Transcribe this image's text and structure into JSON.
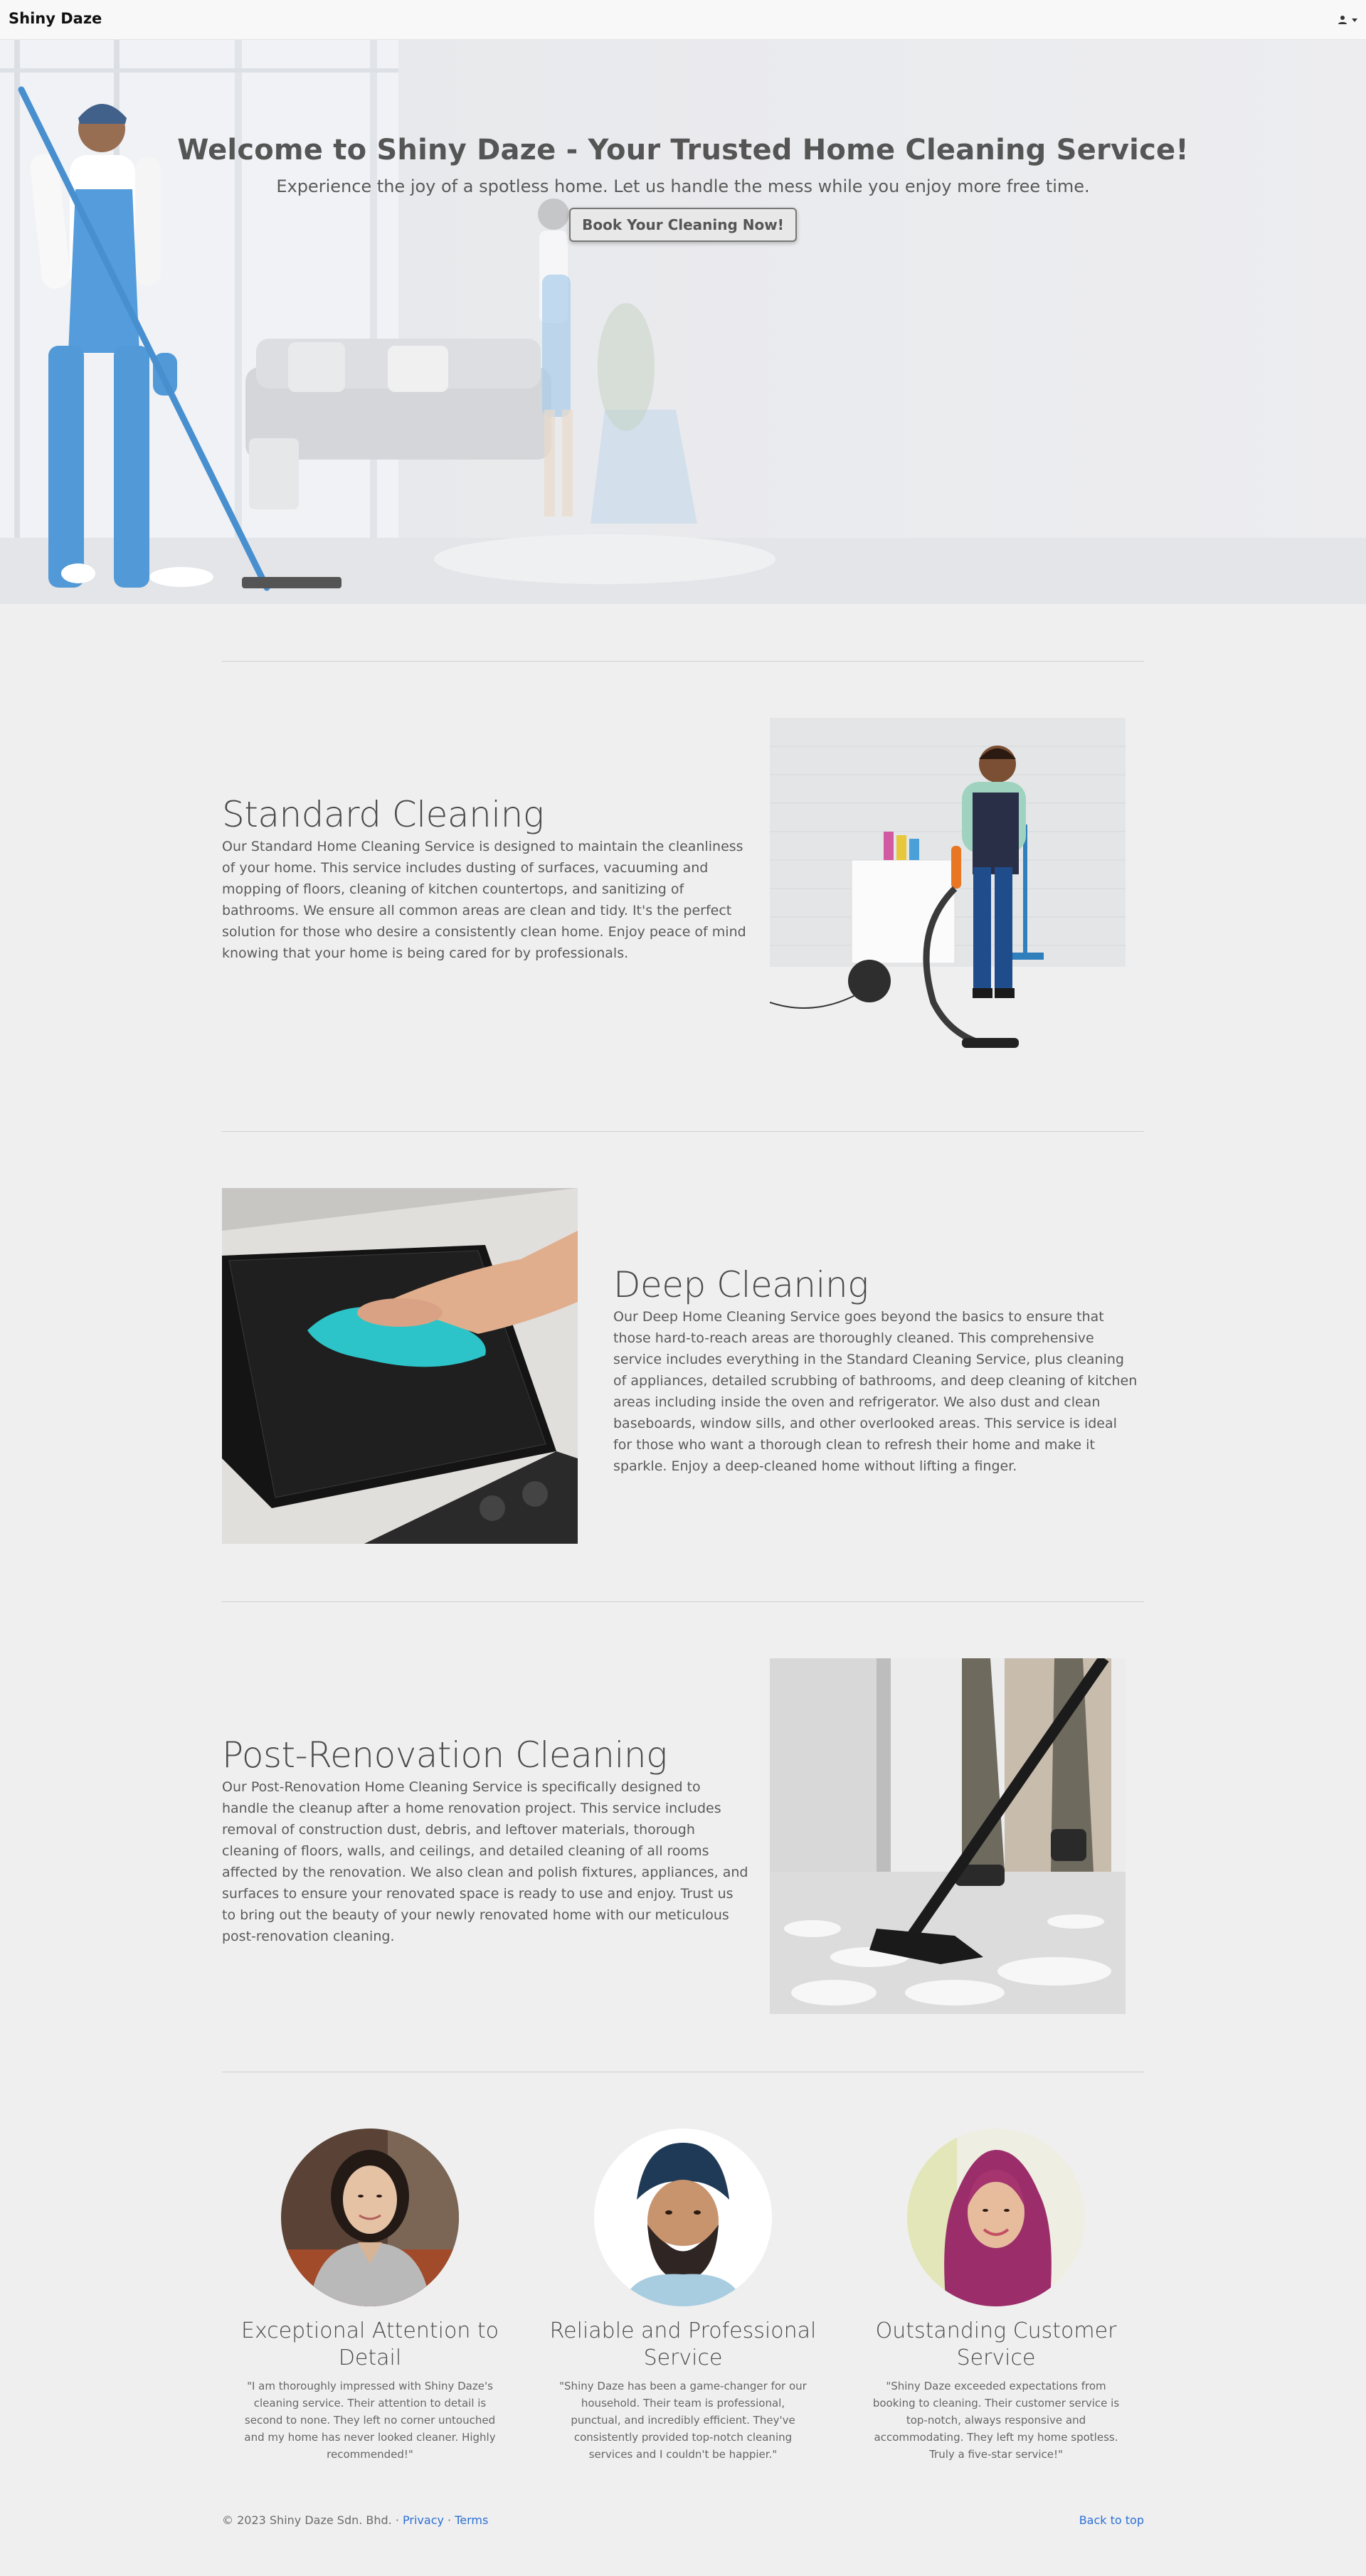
{
  "nav": {
    "brand": "Shiny Daze",
    "user_menu_icon": "user-icon"
  },
  "hero": {
    "title": "Welcome to Shiny Daze - Your Trusted Home Cleaning Service!",
    "subtitle": "Experience the joy of a spotless home. Let us handle the mess while you enjoy more free time.",
    "cta": "Book Your Cleaning Now!"
  },
  "features": [
    {
      "title": "Standard Cleaning",
      "body": "Our Standard Home Cleaning Service is designed to maintain the cleanliness of your home. This service includes dusting of surfaces, vacuuming and mopping of floors, cleaning of kitchen countertops, and sanitizing of bathrooms. We ensure all common areas are clean and tidy. It's the perfect solution for those who desire a consistently clean home. Enjoy peace of mind knowing that your home is being cared for by professionals."
    },
    {
      "title": "Deep Cleaning",
      "body": "Our Deep Home Cleaning Service goes beyond the basics to ensure that those hard-to-reach areas are thoroughly cleaned. This comprehensive service includes everything in the Standard Cleaning Service, plus cleaning of appliances, detailed scrubbing of bathrooms, and deep cleaning of kitchen areas including inside the oven and refrigerator. We also dust and clean baseboards, window sills, and other overlooked areas. This service is ideal for those who want a thorough clean to refresh their home and make it sparkle. Enjoy a deep-cleaned home without lifting a finger."
    },
    {
      "title": "Post-Renovation Cleaning",
      "body": "Our Post-Renovation Home Cleaning Service is specifically designed to handle the cleanup after a home renovation project. This service includes removal of construction dust, debris, and leftover materials, thorough cleaning of floors, walls, and ceilings, and detailed cleaning of all rooms affected by the renovation. We also clean and polish fixtures, appliances, and surfaces to ensure your renovated space is ready to use and enjoy. Trust us to bring out the beauty of your newly renovated home with our meticulous post-renovation cleaning."
    }
  ],
  "testimonials": [
    {
      "title": "Exceptional Attention to Detail",
      "quote": "\"I am thoroughly impressed with Shiny Daze's cleaning service. Their attention to detail is second to none. They left no corner untouched and my home has never looked cleaner. Highly recommended!\""
    },
    {
      "title": "Reliable and Professional Service",
      "quote": "\"Shiny Daze has been a game-changer for our household. Their team is professional, punctual, and incredibly efficient. They've consistently provided top-notch cleaning services and I couldn't be happier.\""
    },
    {
      "title": "Outstanding Customer Service",
      "quote": "\"Shiny Daze exceeded expectations from booking to cleaning. Their customer service is top-notch, always responsive and accommodating. They left my home spotless. Truly a five-star service!\""
    }
  ],
  "footer": {
    "copyright": "© 2023 Shiny Daze Sdn. Bhd. · ",
    "privacy": "Privacy",
    "sep": " · ",
    "terms": "Terms",
    "back_to_top": "Back to top"
  },
  "colors": {
    "link": "#2c6fd6",
    "hero_uniform": "#3d8fd6",
    "background": "#efefef"
  }
}
